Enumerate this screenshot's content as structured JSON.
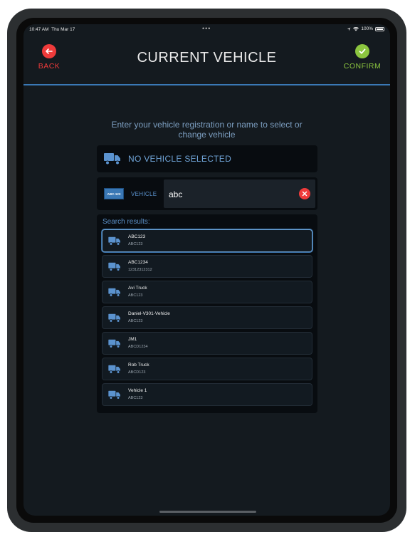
{
  "status": {
    "time": "10:47 AM",
    "date": "Thu Mar 17",
    "battery": "100%",
    "dots": "•••"
  },
  "header": {
    "back_label": "BACK",
    "title": "CURRENT VEHICLE",
    "confirm_label": "CONFIRM"
  },
  "prompt": {
    "line1": "Enter your vehicle registration or name to select or",
    "line2": "change vehicle"
  },
  "current": {
    "label": "NO VEHICLE SELECTED"
  },
  "search": {
    "plate_text": "ABC-123",
    "field_label": "VEHICLE",
    "value": "abc"
  },
  "results": {
    "title": "Search results:",
    "items": [
      {
        "name": "ABC123",
        "reg": "ABC123"
      },
      {
        "name": "ABC1234",
        "reg": "12312312312"
      },
      {
        "name": "Avi Truck",
        "reg": "ABC123"
      },
      {
        "name": "Daniel-V301-Vehicle",
        "reg": "ABC123"
      },
      {
        "name": "JM1",
        "reg": "ABCD1234"
      },
      {
        "name": "Rob Truck",
        "reg": "ABCD123"
      },
      {
        "name": "Vehicle 1",
        "reg": "ABC123"
      }
    ]
  },
  "colors": {
    "accent": "#3a78b5",
    "back": "#ef3b3b",
    "confirm": "#8cc63f",
    "background": "#141a1f"
  },
  "icons": {
    "back": "arrow-left-icon",
    "confirm": "checkmark-icon",
    "vehicle": "truck-icon",
    "clear": "close-icon"
  }
}
